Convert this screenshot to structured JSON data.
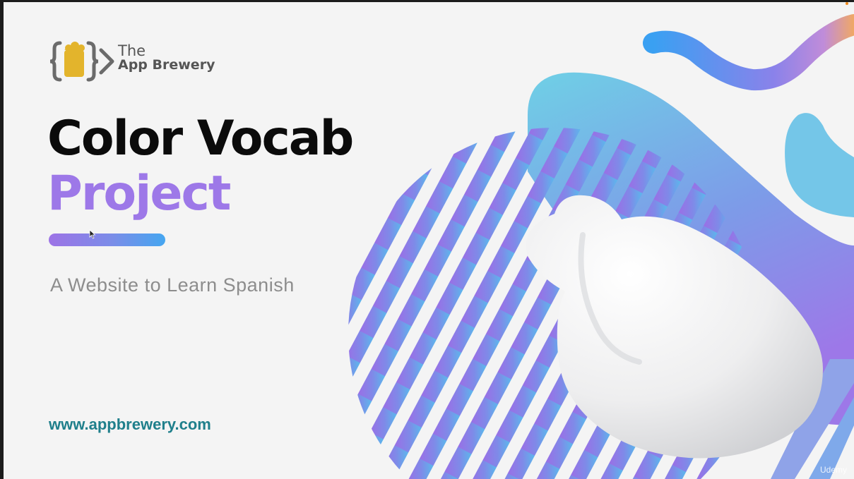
{
  "brand": {
    "line1": "The",
    "line2": "App Brewery"
  },
  "title": {
    "line1": "Color Vocab",
    "line2": "Project"
  },
  "subtitle": "A Website to Learn Spanish",
  "website": "www.appbrewery.com",
  "watermark": "Udemy",
  "colors": {
    "title_dark": "#0b0b0b",
    "title_accent": "#9d78e8",
    "website": "#1f7f8b",
    "subtitle": "#8d8d8d",
    "gradient_purple": "#9d73e6",
    "gradient_blue": "#45a6f0",
    "gradient_cyan": "#6fd0e6",
    "logo_yellow": "#e3b42c"
  },
  "icons": {
    "logo": "curly-braces-beer-mug-icon",
    "cursor": "mouse-pointer-icon"
  }
}
